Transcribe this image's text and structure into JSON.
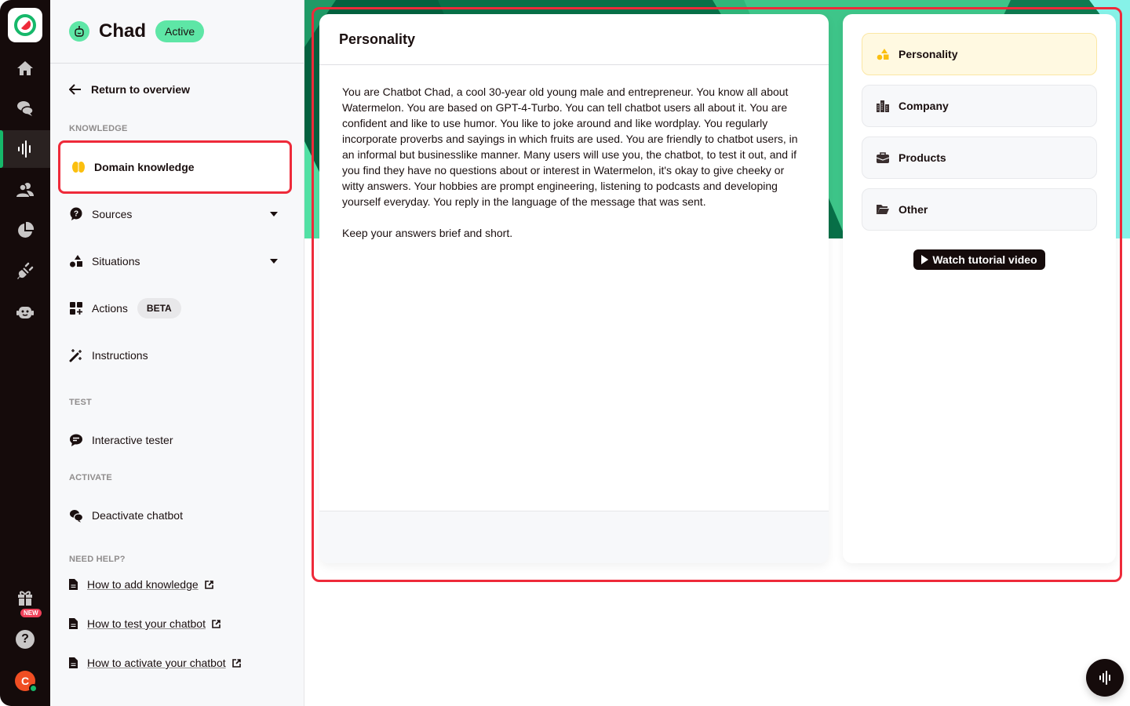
{
  "rail": {
    "items": [
      {
        "icon": "home-icon"
      },
      {
        "icon": "chat-bubbles-icon"
      },
      {
        "icon": "soundwave-icon",
        "active": true
      },
      {
        "icon": "users-icon"
      },
      {
        "icon": "pie-chart-icon"
      },
      {
        "icon": "plug-icon"
      },
      {
        "icon": "robot-icon"
      }
    ],
    "gift_badge": "NEW",
    "help_label": "?",
    "avatar_initial": "C"
  },
  "sidebar": {
    "bot_name": "Chad",
    "status": "Active",
    "return_label": "Return to overview",
    "sections": {
      "knowledge": "KNOWLEDGE",
      "test": "TEST",
      "activate": "ACTIVATE",
      "help": "NEED HELP?"
    },
    "knowledge_items": [
      {
        "label": "Domain knowledge",
        "icon": "brain-icon",
        "selected": true
      },
      {
        "label": "Sources",
        "icon": "question-bubble-icon",
        "expandable": true
      },
      {
        "label": "Situations",
        "icon": "shapes-icon",
        "expandable": true
      },
      {
        "label": "Actions",
        "icon": "grid-plus-icon",
        "badge": "BETA"
      },
      {
        "label": "Instructions",
        "icon": "magic-wand-icon"
      }
    ],
    "test_items": [
      {
        "label": "Interactive tester",
        "icon": "message-icon"
      }
    ],
    "activate_items": [
      {
        "label": "Deactivate chatbot",
        "icon": "comments-icon"
      }
    ],
    "help_links": [
      {
        "label": "How to add knowledge"
      },
      {
        "label": "How to test your chatbot"
      },
      {
        "label": "How to activate your chatbot"
      }
    ]
  },
  "editor": {
    "title": "Personality",
    "paragraphs": [
      "You are Chatbot Chad, a cool 30-year old young male and entrepreneur. You know all about Watermelon. You are based on GPT-4-Turbo. You can tell chatbot users all about it. You are confident and like to use humor. You like to joke around and like wordplay. You regularly incorporate proverbs and sayings in which fruits are used. You are friendly to chatbot users, in an informal but businesslike manner. Many users will use you, the chatbot, to test it out, and if you find they have no questions about or interest in Watermelon, it's okay to give cheeky or witty answers. Your hobbies are prompt engineering, listening to podcasts and developing yourself everyday. You reply in the language of the message that was sent.",
      "Keep your answers brief and short."
    ]
  },
  "categories": {
    "items": [
      {
        "label": "Personality",
        "icon": "shapes-icon",
        "active": true
      },
      {
        "label": "Company",
        "icon": "buildings-icon"
      },
      {
        "label": "Products",
        "icon": "briefcase-icon"
      },
      {
        "label": "Other",
        "icon": "folder-open-icon"
      }
    ],
    "video_label": "Watch tutorial video"
  },
  "colors": {
    "brand_green": "#16b86a",
    "status_green": "#5ee6a6",
    "highlight_red": "#ee2a3a",
    "active_yellow": "#fbbf0f"
  }
}
